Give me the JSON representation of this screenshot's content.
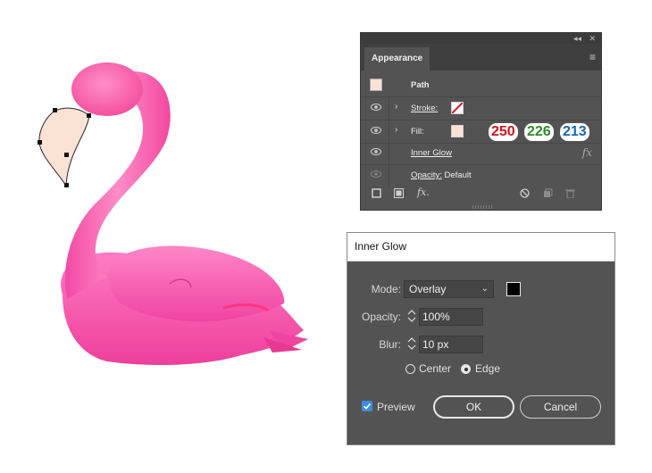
{
  "appearance_panel": {
    "collapse_icon": "double-chevron-left",
    "close_icon": "close",
    "tab_label": "Appearance",
    "menu_icon": "hamburger-menu",
    "object_label": "Path",
    "stroke_label": "Stroke:",
    "fill_label": "Fill:",
    "effect_label": "Inner Glow",
    "opacity_label": "Opacity:",
    "opacity_value": "Default",
    "fill_color": "#fae2d5",
    "fill_rgb": {
      "r": "250",
      "g": "226",
      "b": "213"
    },
    "rgb_colors": {
      "r": "#d0141c",
      "g": "#2d8a2a",
      "b": "#1a66a8"
    },
    "bottom_icons": [
      "add-stroke",
      "add-fill",
      "add-effect",
      "clear-appearance",
      "duplicate-item",
      "delete-item"
    ]
  },
  "inner_glow_dialog": {
    "title": "Inner Glow",
    "mode_label": "Mode:",
    "mode_value": "Overlay",
    "glow_color": "#000000",
    "opacity_label": "Opacity:",
    "opacity_value": "100%",
    "blur_label": "Blur:",
    "blur_value": "10 px",
    "center_label": "Center",
    "edge_label": "Edge",
    "selected_source": "Edge",
    "preview_label": "Preview",
    "preview_checked": true,
    "ok_label": "OK",
    "cancel_label": "Cancel"
  }
}
